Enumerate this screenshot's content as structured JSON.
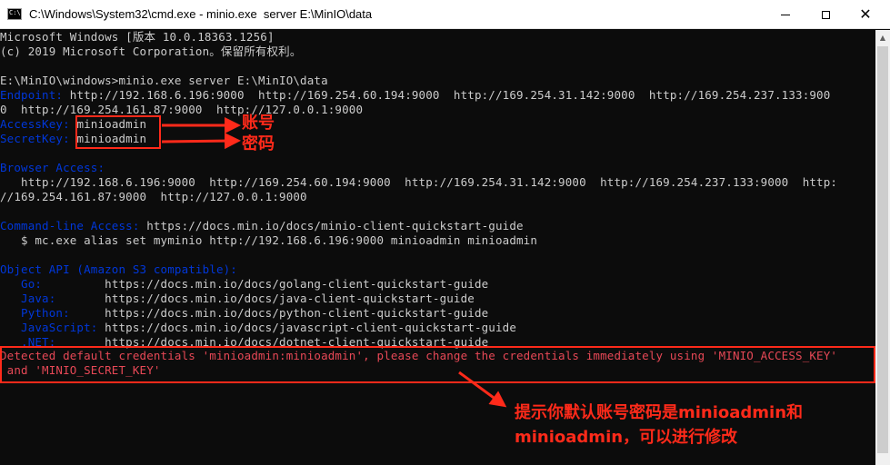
{
  "window": {
    "title": "C:\\Windows\\System32\\cmd.exe - minio.exe  server E:\\MinIO\\data",
    "app_icon_text": "C:\\",
    "minimize_icon": "minimize-icon",
    "maximize_icon": "maximize-icon",
    "close_icon": "close-icon"
  },
  "console": {
    "lines": [
      "Microsoft Windows [版本 10.0.18363.1256]",
      "(c) 2019 Microsoft Corporation。保留所有权利。",
      "",
      "E:\\MinIO\\windows>minio.exe server E:\\MinIO\\data",
      "http://192.168.6.196:9000  http://169.254.60.194:9000  http://169.254.31.142:9000  http://169.254.237.133:900",
      "0  http://169.254.161.87:9000  http://127.0.0.1:9000",
      "minioadmin",
      "minioadmin",
      "",
      "Browser Access:",
      "   http://192.168.6.196:9000  http://169.254.60.194:9000  http://169.254.31.142:9000  http://169.254.237.133:9000  http:",
      "//169.254.161.87:9000  http://127.0.0.1:9000",
      "",
      "https://docs.min.io/docs/minio-client-quickstart-guide",
      "   $ mc.exe alias set myminio http://192.168.6.196:9000 minioadmin minioadmin",
      "",
      "Object API (Amazon S3 compatible):",
      "https://docs.min.io/docs/golang-client-quickstart-guide",
      "https://docs.min.io/docs/java-client-quickstart-guide",
      "https://docs.min.io/docs/python-client-quickstart-guide",
      "https://docs.min.io/docs/javascript-client-quickstart-guide",
      "https://docs.min.io/docs/dotnet-client-quickstart-guide",
      "Detected default credentials 'minioadmin:minioadmin', please change the credentials immediately using 'MINIO_ACCESS_KEY'",
      " and 'MINIO_SECRET_KEY'"
    ],
    "labels": {
      "endpoint": "Endpoint: ",
      "access_key": "AccessKey: ",
      "secret_key": "SecretKey: ",
      "command_line_access": "Command-line Access: ",
      "go": "   Go:         ",
      "java": "   Java:       ",
      "python": "   Python:     ",
      "javascript": "   JavaScript: ",
      "dotnet": "   .NET:       "
    }
  },
  "annotations": {
    "account": "账号",
    "password": "密码",
    "hint_line1": "提示你默认账号密码是minioadmin和",
    "hint_line2": "minioadmin，可以进行修改"
  },
  "colors": {
    "console_bg": "#0c0c0c",
    "console_text": "#cccccc",
    "label_blue": "#0037da",
    "warning_red": "#e74856",
    "annotation_red": "#ff2a1a"
  }
}
